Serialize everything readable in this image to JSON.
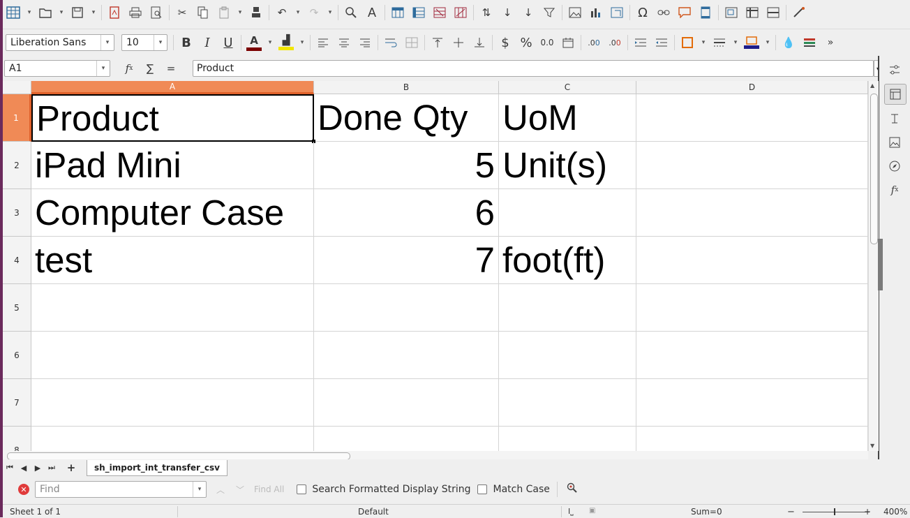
{
  "toolbar1": {
    "icons": [
      "new-spreadsheet-icon",
      "open-icon",
      "save-icon",
      "export-pdf-icon",
      "print-icon",
      "print-preview-icon",
      "cut-icon",
      "copy-icon",
      "paste-icon",
      "clone-formatting-icon",
      "undo-icon",
      "redo-icon",
      "find-replace-icon",
      "spelling-icon",
      "row-icon",
      "column-icon",
      "insert-rows-icon",
      "insert-columns-icon",
      "sort-icon",
      "sort-ascending-icon",
      "sort-descending-icon",
      "autofilter-icon",
      "insert-image-icon",
      "insert-chart-icon",
      "pivot-table-icon",
      "special-character-icon",
      "hyperlink-icon",
      "comment-icon",
      "headers-footers-icon",
      "define-print-area-icon",
      "freeze-rows-icon",
      "split-window-icon",
      "show-draw-functions-icon"
    ]
  },
  "toolbar2": {
    "font_name": "Liberation Sans",
    "font_size": "10",
    "font_color": "#7b0000",
    "highlight_color": "#f2e600",
    "border_color": "#e36c09",
    "bg_color": "#1d1d8a"
  },
  "formula_bar": {
    "cell_ref": "A1",
    "function_wizard": "f",
    "sum_symbol": "∑",
    "equals_symbol": "=",
    "content": "Product"
  },
  "grid": {
    "columns": [
      "A",
      "B",
      "C",
      "D"
    ],
    "rows": [
      "1",
      "2",
      "3",
      "4",
      "5",
      "6",
      "7",
      "8"
    ],
    "cells": [
      [
        "Product",
        "Done Qty",
        "UoM",
        ""
      ],
      [
        "iPad Mini",
        "5",
        "Unit(s)",
        ""
      ],
      [
        "Computer Case",
        "6",
        "",
        ""
      ],
      [
        "test",
        "7",
        "foot(ft)",
        ""
      ]
    ]
  },
  "sheet_tabs": {
    "active": "sh_import_int_transfer_csv"
  },
  "find_bar": {
    "placeholder": "Find",
    "find_all": "Find All",
    "search_formatted": "Search Formatted Display String",
    "match_case": "Match Case"
  },
  "status_bar": {
    "sheet_info": "Sheet 1 of 1",
    "page_style": "Default",
    "sum": "Sum=0",
    "zoom": "400%"
  },
  "colors": {
    "selected_header": "#f08a56",
    "window_accent": "#6b2a5c"
  }
}
